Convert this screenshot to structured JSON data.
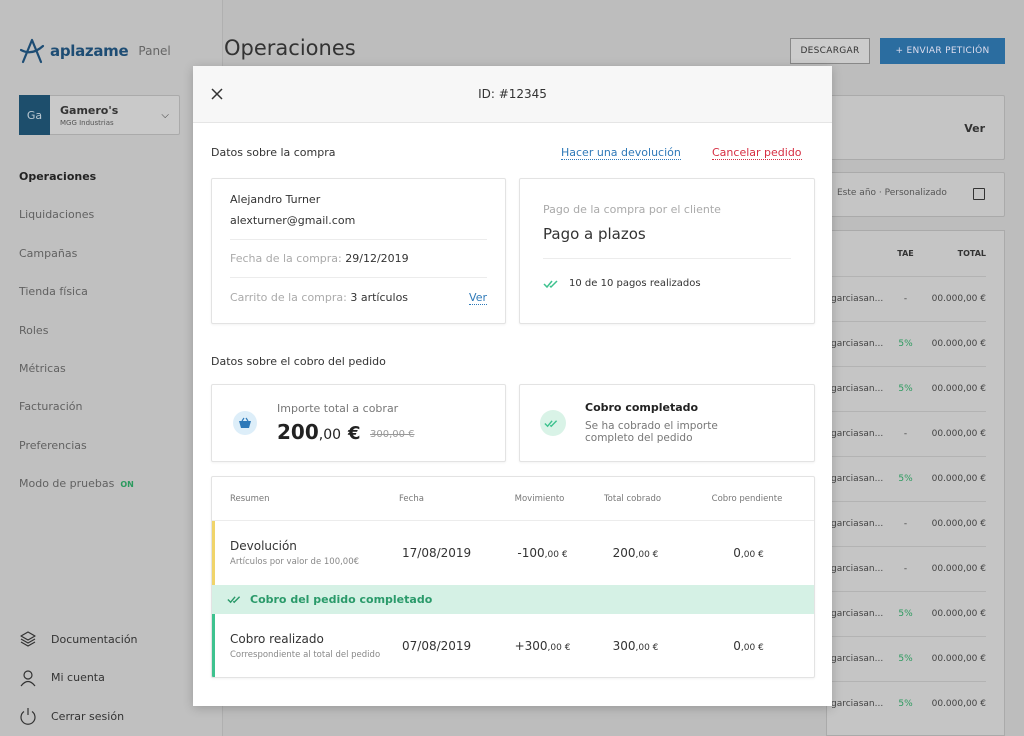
{
  "sidebar": {
    "brand": "aplazame",
    "panel": "Panel",
    "account": {
      "initials": "Ga",
      "name": "Gamero's",
      "company": "MGG Industrias"
    },
    "nav": [
      "Operaciones",
      "Liquidaciones",
      "Campañas",
      "Tienda física",
      "Roles",
      "Métricas",
      "Facturación",
      "Preferencias",
      "Modo de pruebas"
    ],
    "test_mode_badge": "ON",
    "bottom": [
      "Documentación",
      "Mi cuenta",
      "Cerrar sesión"
    ]
  },
  "header": {
    "title": "Operaciones",
    "download": "DESCARGAR",
    "send": "+ ENVIAR PETICIÓN"
  },
  "background": {
    "ver": "Ver",
    "filters": "Este año · Personalizado",
    "columns": [
      "TAE",
      "TOTAL"
    ],
    "rows": [
      {
        "user": "garciasan...",
        "tae": "-",
        "total": "00.000,00 €"
      },
      {
        "user": "garciasan...",
        "tae": "5%",
        "total": "00.000,00 €"
      },
      {
        "user": "garciasan...",
        "tae": "5%",
        "total": "00.000,00 €"
      },
      {
        "user": "garciasan...",
        "tae": "-",
        "total": "00.000,00 €"
      },
      {
        "user": "garciasan...",
        "tae": "5%",
        "total": "00.000,00 €"
      },
      {
        "user": "garciasan...",
        "tae": "-",
        "total": "00.000,00 €"
      },
      {
        "user": "garciasan...",
        "tae": "-",
        "total": "00.000,00 €"
      },
      {
        "user": "garciasan...",
        "tae": "5%",
        "total": "00.000,00 €"
      },
      {
        "user": "garciasan...",
        "tae": "5%",
        "total": "00.000,00 €"
      },
      {
        "user": "garciasan...",
        "tae": "5%",
        "total": "00.000,00 €"
      }
    ]
  },
  "modal": {
    "id": "ID: #12345",
    "section_purchase": "Datos sobre la compra",
    "refund_link": "Hacer una devolución",
    "cancel_link": "Cancelar pedido",
    "customer": {
      "name": "Alejandro Turner",
      "email": "alexturner@gmail.com",
      "date_label": "Fecha de la compra:",
      "date": "29/12/2019",
      "cart_label": "Carrito de la compra:",
      "cart": "3 artículos",
      "view": "Ver"
    },
    "payment": {
      "label": "Pago de la compra por el cliente",
      "value": "Pago a plazos",
      "status": "10 de 10 pagos realizados"
    },
    "section_collection": "Datos sobre el cobro del pedido",
    "amount": {
      "label": "Importe total a cobrar",
      "int": "200",
      "dec": ",00",
      "currency": "€",
      "old": "300,00 €"
    },
    "collected": {
      "title": "Cobro completado",
      "desc": "Se ha cobrado el importe completo del pedido"
    },
    "table": {
      "headers": [
        "Resumen",
        "Fecha",
        "Movimiento",
        "Total cobrado",
        "Cobro pendiente"
      ],
      "row1": {
        "title": "Devolución",
        "sub": "Artículos por valor de 100,00€",
        "date": "17/08/2019",
        "mov_int": "-100",
        "mov_dec": ",00 €",
        "total_int": "200",
        "total_dec": ",00 €",
        "pend_int": "0",
        "pend_dec": ",00 €"
      },
      "band": "Cobro del pedido completado",
      "row2": {
        "title": "Cobro realizado",
        "sub": "Correspondiente al total del pedido",
        "date": "07/08/2019",
        "mov_int": "+300",
        "mov_dec": ",00 €",
        "total_int": "300",
        "total_dec": ",00 €",
        "pend_int": "0",
        "pend_dec": ",00 €"
      }
    }
  },
  "colors": {
    "brand": "#1e4d74",
    "link": "#2e79b8",
    "danger": "#d62e42",
    "success": "#3ec28f",
    "warning": "#f0d46a"
  }
}
